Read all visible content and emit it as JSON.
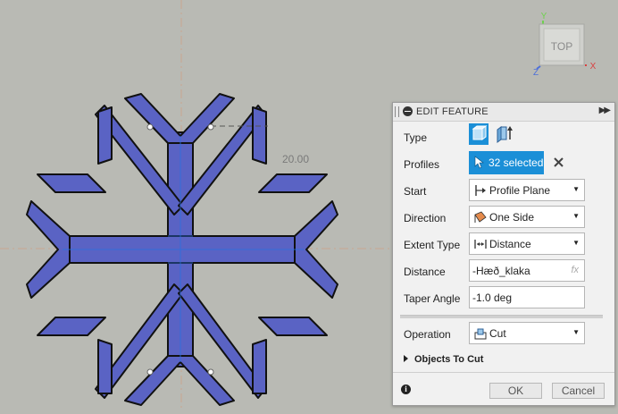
{
  "viewport": {
    "dimension_value": "20.00",
    "view_cube": {
      "face": "TOP",
      "axes": [
        "X",
        "Y",
        "Z"
      ]
    }
  },
  "panel": {
    "title": "EDIT FEATURE",
    "rows": {
      "type": {
        "label": "Type",
        "options": [
          "solid-extrude-icon",
          "surface-extrude-icon"
        ]
      },
      "profiles": {
        "label": "Profiles",
        "value": "32 selected"
      },
      "start": {
        "label": "Start",
        "value": "Profile Plane"
      },
      "direction": {
        "label": "Direction",
        "value": "One Side"
      },
      "extent_type": {
        "label": "Extent Type",
        "value": "Distance"
      },
      "distance": {
        "label": "Distance",
        "value": "-Hæð_klaka",
        "fx": "fx"
      },
      "taper_angle": {
        "label": "Taper Angle",
        "value": "-1.0 deg"
      },
      "operation": {
        "label": "Operation",
        "value": "Cut"
      }
    },
    "objects_to_cut": "Objects To Cut",
    "ok": "OK",
    "cancel": "Cancel",
    "colors": {
      "accent": "#1b8fd7",
      "profile_fill": "#5a63c4"
    }
  }
}
